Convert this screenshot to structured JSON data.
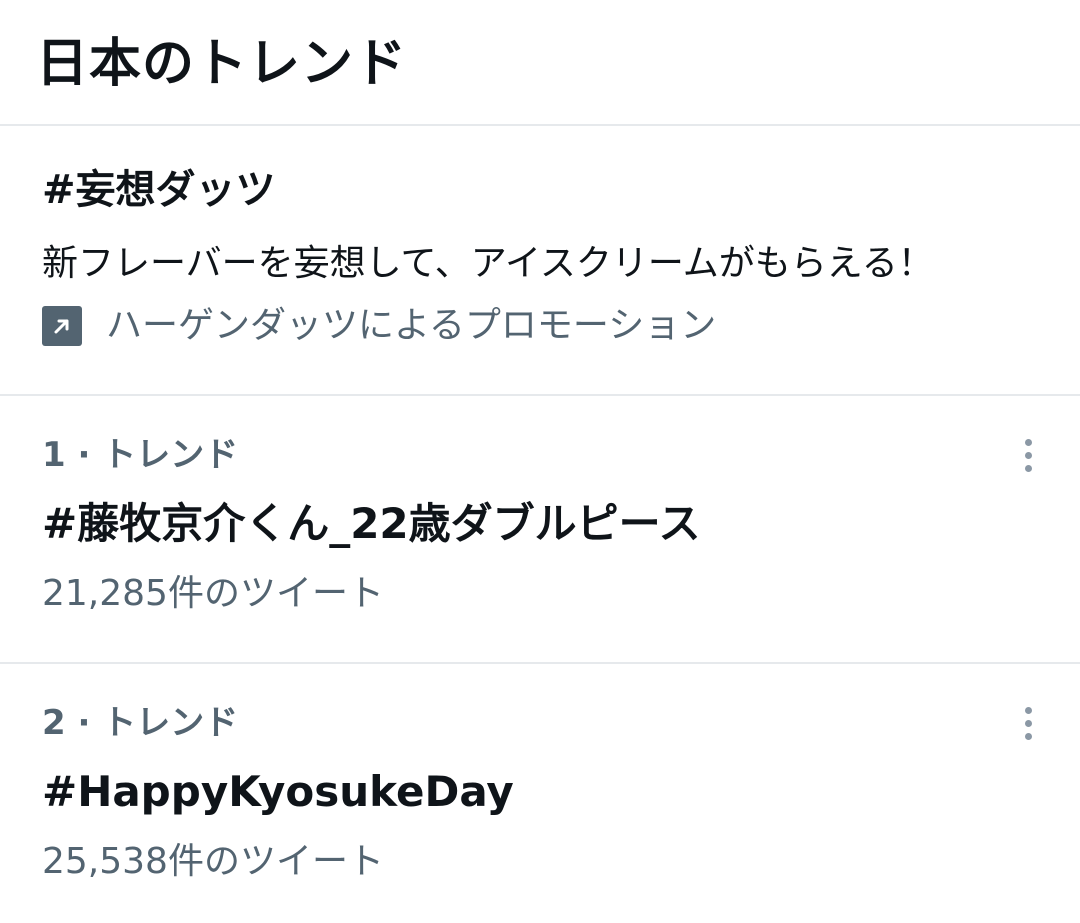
{
  "header": {
    "title": "日本のトレンド"
  },
  "promoted": {
    "hashtag": "#妄想ダッツ",
    "description": "新フレーバーを妄想して、アイスクリームがもらえる！",
    "promoted_by": "ハーゲンダッツによるプロモーション",
    "icon": "promoted-arrow-icon"
  },
  "trends": [
    {
      "meta": "1 · トレンド",
      "name": "#藤牧京介くん_22歳ダブルピース",
      "count": "21,285件のツイート"
    },
    {
      "meta": "2 · トレンド",
      "name": "#HappyKyosukeDay",
      "count": "25,538件のツイート"
    }
  ],
  "colors": {
    "primary_text": "#0f1419",
    "secondary_text": "#536471",
    "divider": "#e6e9ec",
    "more_dots": "#8b98a5"
  }
}
